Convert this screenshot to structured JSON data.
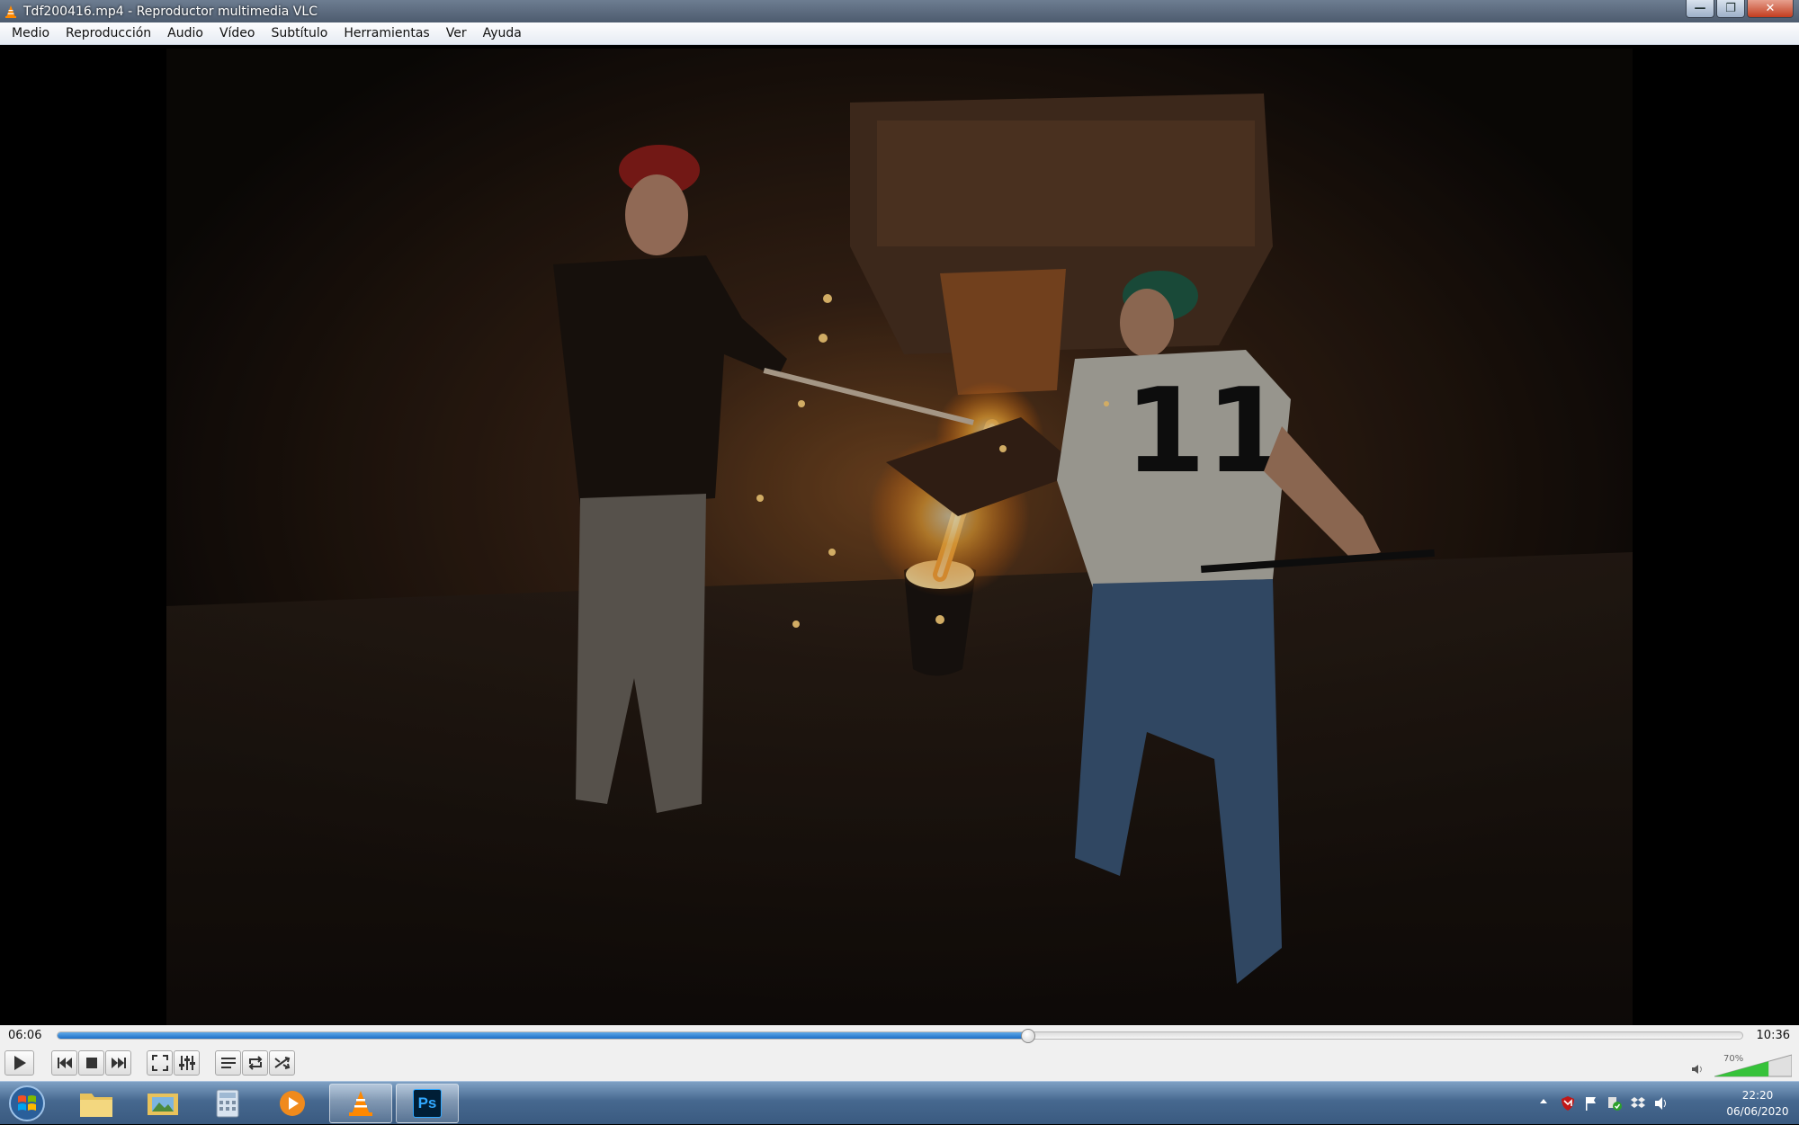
{
  "window": {
    "title": "Tdf200416.mp4 - Reproductor multimedia VLC",
    "controls": [
      "minimize",
      "maximize",
      "close"
    ]
  },
  "menu": [
    "Medio",
    "Reproducción",
    "Audio",
    "Vídeo",
    "Subtítulo",
    "Herramientas",
    "Ver",
    "Ayuda"
  ],
  "video": {
    "description_icon": "video-frame"
  },
  "playback": {
    "elapsed": "06:06",
    "total": "10:36",
    "progress": 0.576
  },
  "controls": {
    "buttons": [
      "play-icon",
      "previous-icon",
      "stop-icon",
      "next-icon",
      "fullscreen-icon",
      "extended-settings-icon",
      "playlist-icon",
      "loop-icon",
      "shuffle-icon"
    ],
    "volume_percent": "70%",
    "volume_level": 0.7
  },
  "taskbar": {
    "apps": [
      "windows-explorer",
      "image-viewer",
      "calculator",
      "media-player",
      "vlc",
      "photoshop"
    ],
    "photoshop_label": "Ps",
    "time": "22:20",
    "date": "06/06/2020"
  },
  "colors": {
    "seek_fill": "#1d6fc6",
    "volume_fill": "#36c23a",
    "vlc_orange": "#ff8800",
    "photoshop_bg": "#001e36",
    "photoshop_text": "#31a8ff"
  }
}
